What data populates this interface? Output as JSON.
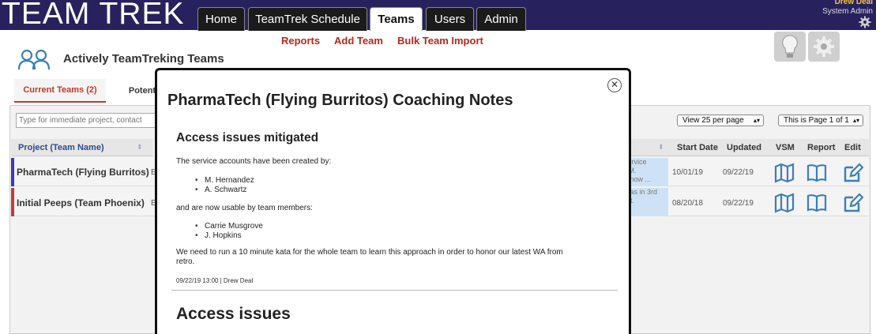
{
  "header": {
    "logo": "TEAM TREK",
    "nav": [
      "Home",
      "TeamTrek Schedule",
      "Teams",
      "Users",
      "Admin"
    ],
    "active_nav": "Teams",
    "user_name": "Drew Deal",
    "user_role": "System Admin"
  },
  "subnav": [
    "Reports",
    "Add Team",
    "Bulk Team Import"
  ],
  "page": {
    "title": "Actively TeamTreking Teams"
  },
  "subtabs": {
    "current": "Current Teams (2)",
    "potential": "Potent"
  },
  "filter": {
    "placeholder": "Type for immediate project, contact"
  },
  "per_page": "View 25 per page",
  "paging": "This is Page 1 of 1",
  "table": {
    "headers": {
      "project": "Project (Team Name)",
      "start": "Start Date",
      "updated": "Updated",
      "vsm": "VSM",
      "report": "Report",
      "edit": "Edit"
    },
    "rows": [
      {
        "name": "PharmaTech (Flying Burritos)",
        "trunc": "E",
        "summary": "service\n- M.\ne now ...",
        "start": "10/01/19",
        "updated": "09/22/19",
        "color": "#3b3bb0"
      },
      {
        "name": "Initial Peeps (Team Phoenix)",
        "trunc": "E",
        "summary": "atas in 3rd\nart.",
        "start": "08/20/18",
        "updated": "09/22/19",
        "color": "#c03a3a"
      }
    ]
  },
  "modal": {
    "title": "PharmaTech (Flying Burritos) Coaching Notes",
    "note": {
      "heading": "Access issues mitigated",
      "p1": "The service accounts have been created by:",
      "list1": [
        "M. Hernandez",
        "A. Schwartz"
      ],
      "p2": "and are now usable by team members:",
      "list2": [
        "Carrie Musgrove",
        "J. Hopkins"
      ],
      "p3_line1": "We need to run a 10 minute kata for the whole team to learn this approach in order to honor our latest WA from",
      "p3_line2": "retro.",
      "meta": "09/22/19 13:00 | Drew Deal"
    },
    "next_heading": "Access issues"
  },
  "colors": {
    "header_bg": "#27225e",
    "accent": "#c0392b",
    "icon_blue": "#3b7fb8"
  }
}
